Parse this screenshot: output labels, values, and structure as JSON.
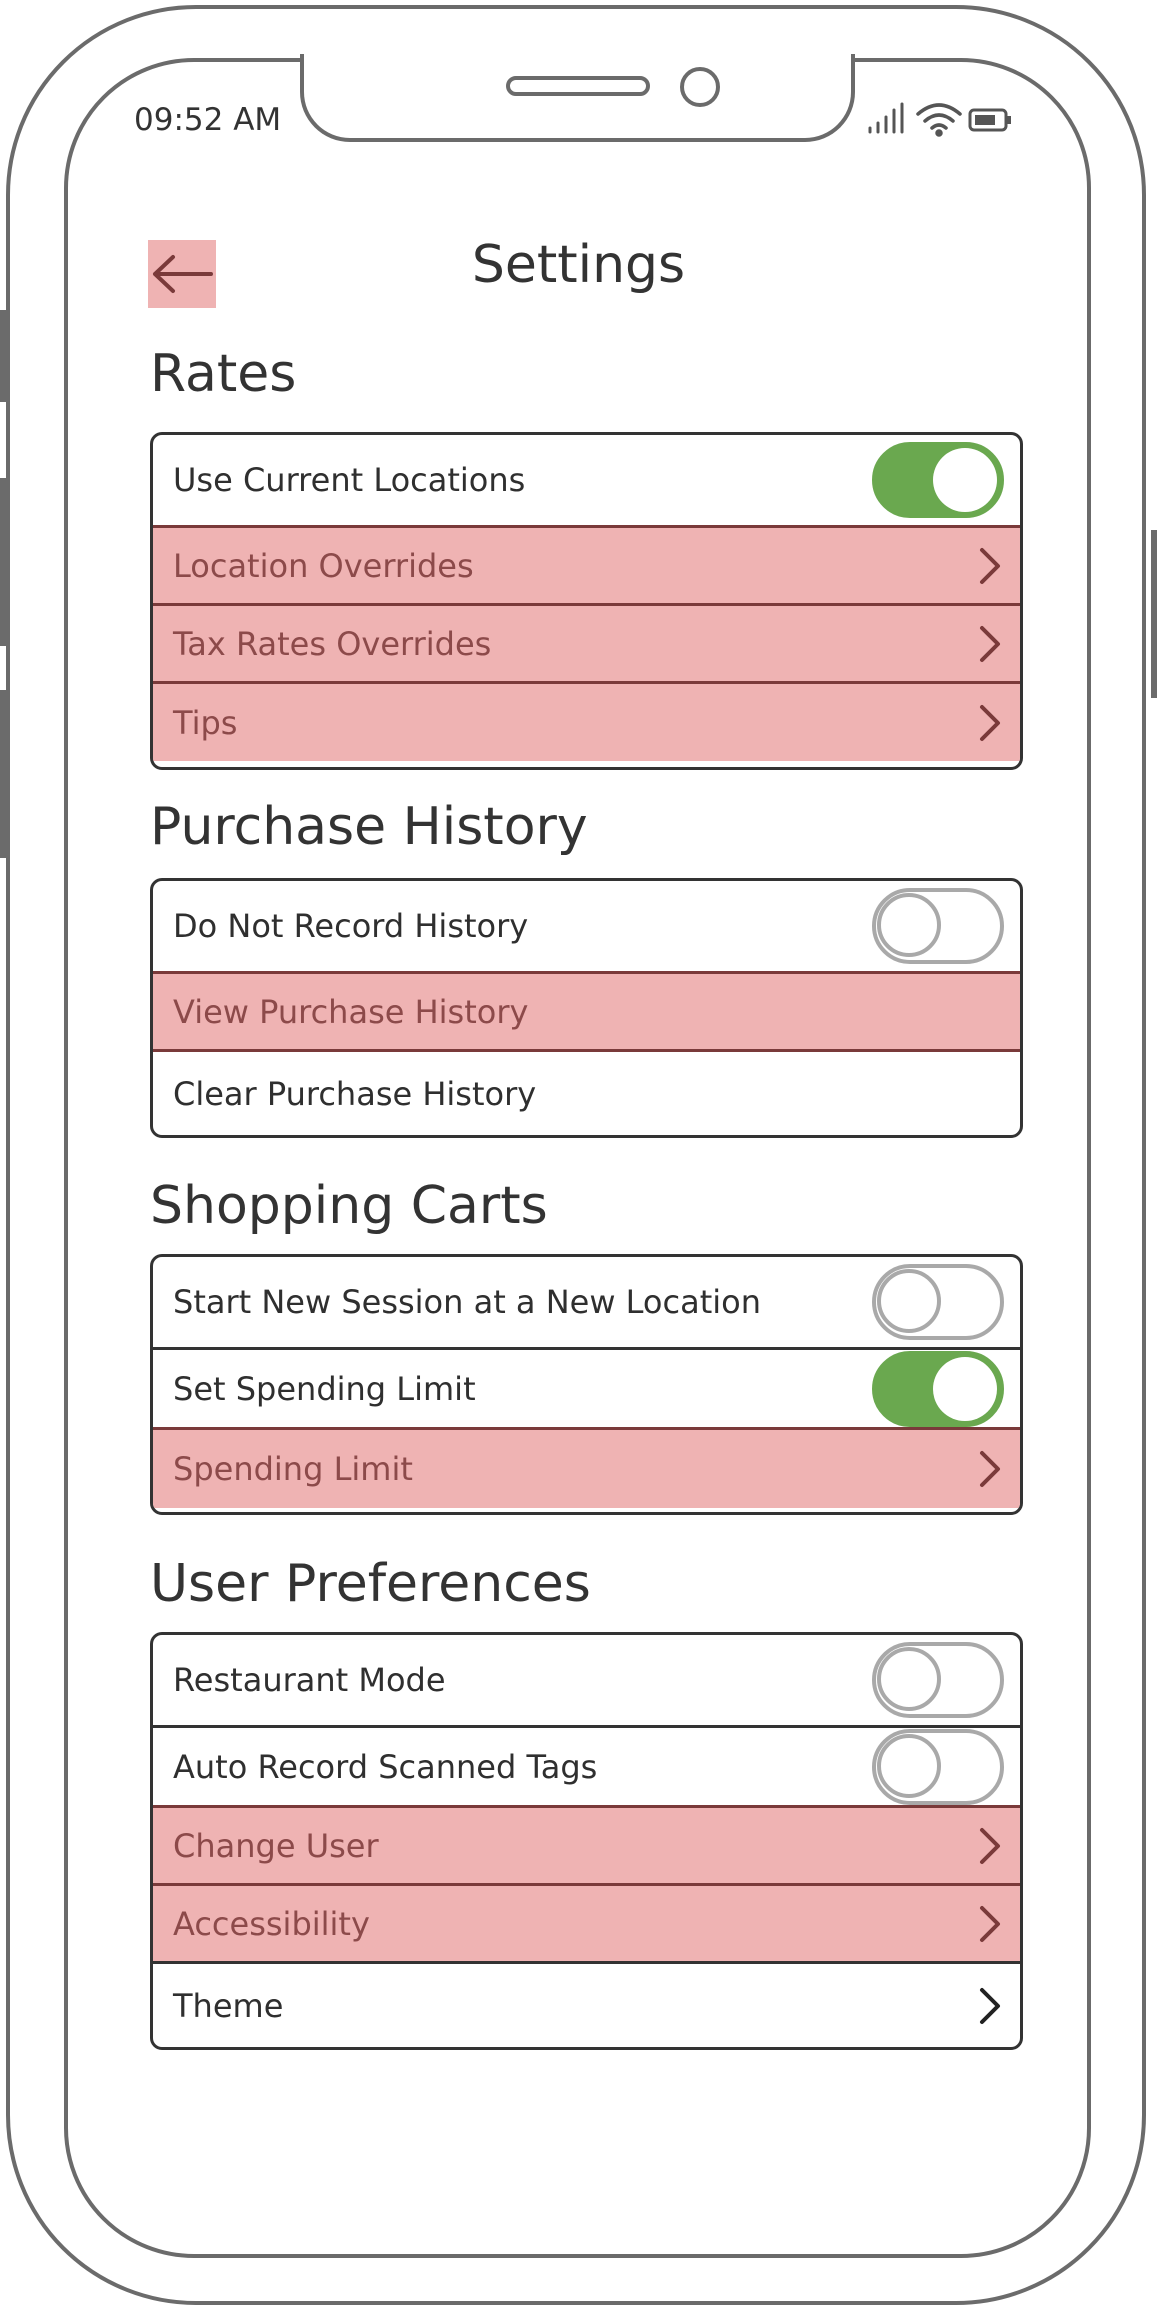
{
  "status_bar": {
    "time": "09:52 AM"
  },
  "header": {
    "title": "Settings",
    "back_icon": "arrow-left-icon"
  },
  "colors": {
    "highlight": "#efb3b3",
    "toggle_on": "#6aa84f",
    "toggle_off": "#a9a9a9"
  },
  "sections": [
    {
      "title": "Rates",
      "rows": [
        {
          "label": "Use Current Locations",
          "control": "toggle",
          "toggle_on": true,
          "highlighted": false
        },
        {
          "label": "Location Overrides",
          "control": "chevron",
          "highlighted": true
        },
        {
          "label": "Tax Rates Overrides",
          "control": "chevron",
          "highlighted": true
        },
        {
          "label": "Tips",
          "control": "chevron",
          "highlighted": true
        }
      ]
    },
    {
      "title": "Purchase History",
      "rows": [
        {
          "label": "Do Not Record History",
          "control": "toggle",
          "toggle_on": false,
          "highlighted": false
        },
        {
          "label": "View Purchase History",
          "control": "none",
          "highlighted": true
        },
        {
          "label": "Clear Purchase History",
          "control": "none",
          "highlighted": false
        }
      ]
    },
    {
      "title": "Shopping Carts",
      "rows": [
        {
          "label": "Start New Session at a New Location",
          "control": "toggle",
          "toggle_on": false,
          "highlighted": false
        },
        {
          "label": "Set Spending Limit",
          "control": "toggle",
          "toggle_on": true,
          "highlighted": false
        },
        {
          "label": "Spending Limit",
          "control": "chevron",
          "highlighted": true
        }
      ]
    },
    {
      "title": "User Preferences",
      "rows": [
        {
          "label": "Restaurant Mode",
          "control": "toggle",
          "toggle_on": false,
          "highlighted": false
        },
        {
          "label": "Auto Record Scanned Tags",
          "control": "toggle",
          "toggle_on": false,
          "highlighted": false
        },
        {
          "label": "Change User",
          "control": "chevron",
          "highlighted": true
        },
        {
          "label": "Accessibility",
          "control": "chevron",
          "highlighted": true
        },
        {
          "label": "Theme",
          "control": "chevron",
          "highlighted": false
        }
      ]
    }
  ]
}
